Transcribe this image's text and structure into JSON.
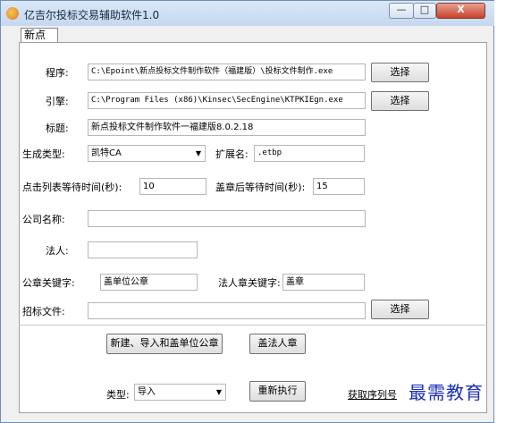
{
  "window": {
    "title": "亿吉尔投标交易辅助软件1.0",
    "min_glyph": "—",
    "max_glyph": "□",
    "close_glyph": "X"
  },
  "tab": {
    "label": "新点"
  },
  "form": {
    "program_label": "程序:",
    "program_value": "C:\\Epoint\\新点投标文件制作软件（福建版）\\投标文件制作.exe",
    "program_button": "选择",
    "engine_label": "引擎:",
    "engine_value": "C:\\Program Files (x86)\\Kinsec\\SecEngine\\KTPKIEgn.exe",
    "engine_button": "选择",
    "title_label": "标题:",
    "title_value": "新点投标文件制作软件一福建版8.0.2.18",
    "gen_type_label": "生成类型:",
    "gen_type_value": "凯特CA",
    "ext_label": "扩展名:",
    "ext_value": ".etbp",
    "wait_list_label": "点击列表等待时间(秒):",
    "wait_list_value": "10",
    "wait_stamp_label": "盖章后等待时间(秒):",
    "wait_stamp_value": "15",
    "company_label": "公司名称:",
    "company_value": "",
    "legal_label": "法人:",
    "legal_value": "",
    "seal_kw_label": "公章关键字:",
    "seal_kw_value": "盖单位公章",
    "legal_seal_kw_label": "法人章关键字:",
    "legal_seal_kw_value": "盖章",
    "tender_file_label": "招标文件:",
    "tender_file_value": "",
    "tender_file_button": "选择"
  },
  "actions": {
    "new_import_seal": "新建、导入和盖单位公章",
    "legal_seal": "盖法人章",
    "type_label": "类型:",
    "type_value": "导入",
    "rerun": "重新执行",
    "get_serial": "获取序列号"
  },
  "watermark": "最需教育"
}
